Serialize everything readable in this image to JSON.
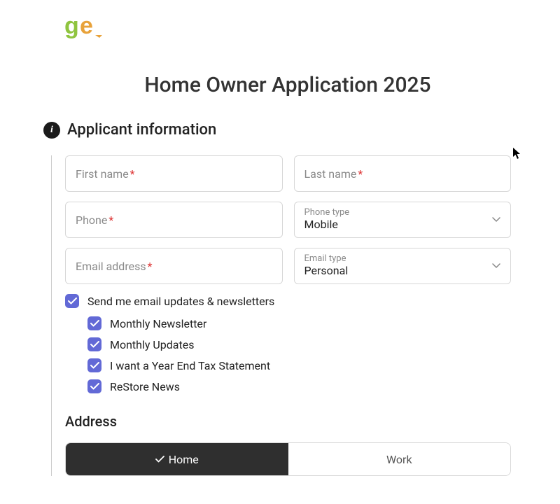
{
  "title": "Home Owner Application 2025",
  "section1": {
    "heading": "Applicant information"
  },
  "fields": {
    "first_name": {
      "label": "First name"
    },
    "last_name": {
      "label": "Last name"
    },
    "phone": {
      "label": "Phone"
    },
    "phone_type": {
      "label": "Phone type",
      "value": "Mobile"
    },
    "email": {
      "label": "Email address"
    },
    "email_type": {
      "label": "Email type",
      "value": "Personal"
    }
  },
  "checks": {
    "main": "Send me email updates & newsletters",
    "subs": [
      "Monthly Newsletter",
      "Monthly Updates",
      "I want a Year End Tax Statement",
      "ReStore News"
    ]
  },
  "address": {
    "heading": "Address",
    "tabs": {
      "home": "Home",
      "work": "Work"
    }
  }
}
